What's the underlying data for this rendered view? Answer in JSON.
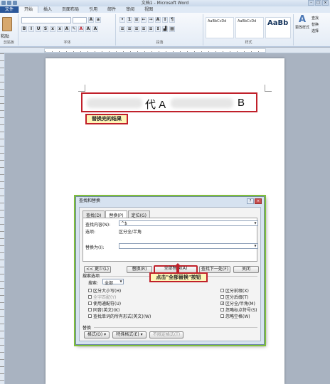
{
  "window": {
    "title": "文档1 - Microsoft Word"
  },
  "tabs": [
    {
      "label": "文件"
    },
    {
      "label": "开始"
    },
    {
      "label": "插入"
    },
    {
      "label": "页面布局"
    },
    {
      "label": "引用"
    },
    {
      "label": "邮件"
    },
    {
      "label": "审阅"
    },
    {
      "label": "视图"
    }
  ],
  "ribbon": {
    "paste_label": "粘贴",
    "groups": {
      "clipboard": "剪贴板",
      "font": "字体",
      "paragraph": "段落",
      "styles": "样式"
    },
    "styles": [
      {
        "label": "AaBbCcDd"
      },
      {
        "label": "AaBbCcDd"
      },
      {
        "label": "AaBb"
      }
    ],
    "change_styles": "更改样式",
    "editing": [
      "查找",
      "替换",
      "选择"
    ]
  },
  "document": {
    "result_glyph_1": "代 A",
    "result_glyph_2": "B",
    "callout_result": "替换完的结果"
  },
  "dialog": {
    "title": "查找和替换",
    "title_buttons": [
      "?",
      "×"
    ],
    "tabs": [
      {
        "label": "查找(D)"
      },
      {
        "label": "替换(P)"
      },
      {
        "label": "定位(G)"
      }
    ],
    "find_label": "查找内容(N):",
    "find_value": "^$",
    "options_label": "选项:",
    "options_value": "区分全/半角",
    "replace_label": "替换为(I):",
    "replace_value": "",
    "buttons": {
      "less": "<< 更少(L)",
      "replace": "替换(R)",
      "replace_all": "全部替换(A)",
      "find_next": "查找下一处(F)",
      "close": "关闭"
    },
    "callout_replace_all": "点击\"全部替换\"按钮",
    "search_options_label": "搜索选项",
    "search_label": "搜索:",
    "search_value": "全部",
    "left_options": [
      {
        "label": "区分大小写(H)",
        "checked": false
      },
      {
        "label": "全字匹配(Y)",
        "checked": false
      },
      {
        "label": "使用通配符(U)",
        "checked": false
      },
      {
        "label": "同音(英文)(K)",
        "checked": false
      },
      {
        "label": "查找单词的所有形式(英文)(W)",
        "checked": false
      }
    ],
    "right_options": [
      {
        "label": "区分前缀(X)",
        "checked": false
      },
      {
        "label": "区分后缀(T)",
        "checked": false
      },
      {
        "label": "区分全/半角(M)",
        "checked": true
      },
      {
        "label": "忽略标点符号(S)",
        "checked": false
      },
      {
        "label": "忽略空格(W)",
        "checked": false
      }
    ],
    "replace_section_label": "替换",
    "bottom_buttons": {
      "format": "格式(O) ▾",
      "special": "特殊格式(E) ▾",
      "no_format": "不限定格式(T)"
    }
  },
  "colors": {
    "accent": "#c0202a",
    "callout_bg": "#fef6b8",
    "file_tab": "#2b579a"
  }
}
